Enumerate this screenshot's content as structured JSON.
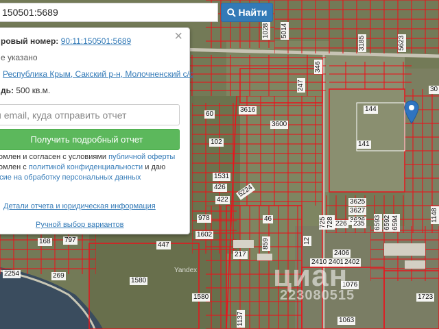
{
  "search": {
    "value": "150501:5689",
    "button_label": "Найти"
  },
  "panel": {
    "cadastral_label": "ровый номер:",
    "cadastral_value": "90:11:150501:5689",
    "status_text": "е указано",
    "address_link": "Республика Крым, Сакский р-н, Молочненский с/с",
    "area_label": "дь:",
    "area_value": "500 кв.м.",
    "email_placeholder": "и email, куда отправить отчет",
    "report_button": "Получить подробный отчет",
    "agree_line1_prefix": "комлен и согласен с условиями ",
    "agree_line1_link": "публичной оферты",
    "agree_line2_prefix": "комлен с ",
    "agree_line2_link": "политикой конфиденциальности",
    "agree_line2_suffix": " и даю",
    "agree_line3_link": "асие на обработку персональных данных",
    "details_link": "Детали отчета и юридическая информация",
    "manual_link": "Ручной выбор вариантов",
    "close_symbol": "×"
  },
  "map": {
    "provider": "Yandex",
    "watermark": "циан",
    "watermark_id": "223080515",
    "parcel_labels": [
      {
        "text": "1028",
        "style": "v"
      },
      {
        "text": "5014",
        "style": "v"
      },
      {
        "text": "3185",
        "style": "v"
      },
      {
        "text": "5623",
        "style": "v"
      },
      {
        "text": "30",
        "style": "h"
      },
      {
        "text": "346",
        "style": "v"
      },
      {
        "text": "247",
        "style": "v"
      },
      {
        "text": "3616",
        "style": "h"
      },
      {
        "text": "3600",
        "style": "h"
      },
      {
        "text": "60",
        "style": "h"
      },
      {
        "text": "102",
        "style": "h"
      },
      {
        "text": "144",
        "style": "h"
      },
      {
        "text": "141",
        "style": "h"
      },
      {
        "text": "1531",
        "style": "h"
      },
      {
        "text": "426",
        "style": "h"
      },
      {
        "text": "422",
        "style": "h"
      },
      {
        "text": "5224",
        "style": "diag"
      },
      {
        "text": "978",
        "style": "h"
      },
      {
        "text": "46",
        "style": "h"
      },
      {
        "text": "3625",
        "style": "h"
      },
      {
        "text": "3627",
        "style": "h"
      },
      {
        "text": "3626",
        "style": "h"
      },
      {
        "text": "725",
        "style": "v"
      },
      {
        "text": "728",
        "style": "v"
      },
      {
        "text": "226",
        "style": "h"
      },
      {
        "text": "235",
        "style": "h"
      },
      {
        "text": "6593",
        "style": "v"
      },
      {
        "text": "6592",
        "style": "v"
      },
      {
        "text": "6594",
        "style": "v"
      },
      {
        "text": "1148",
        "style": "v"
      },
      {
        "text": "1602",
        "style": "h"
      },
      {
        "text": "447",
        "style": "h"
      },
      {
        "text": "217",
        "style": "h"
      },
      {
        "text": "859",
        "style": "v"
      },
      {
        "text": "12",
        "style": "v"
      },
      {
        "text": "2406",
        "style": "h"
      },
      {
        "text": "2410",
        "style": "h"
      },
      {
        "text": "2401",
        "style": "h"
      },
      {
        "text": "2402",
        "style": "h"
      },
      {
        "text": "168",
        "style": "h"
      },
      {
        "text": "797",
        "style": "h"
      },
      {
        "text": "269",
        "style": "h"
      },
      {
        "text": "2254",
        "style": "h"
      },
      {
        "text": "1580",
        "style": "h"
      },
      {
        "text": "1580",
        "style": "h"
      },
      {
        "text": "1076",
        "style": "h"
      },
      {
        "text": "1723",
        "style": "h"
      },
      {
        "text": "1137",
        "style": "v"
      },
      {
        "text": "1063",
        "style": "h"
      }
    ]
  },
  "colors": {
    "boundary": "#e8141c",
    "accent_blue": "#337ab7",
    "report_green": "#5cb85c"
  }
}
